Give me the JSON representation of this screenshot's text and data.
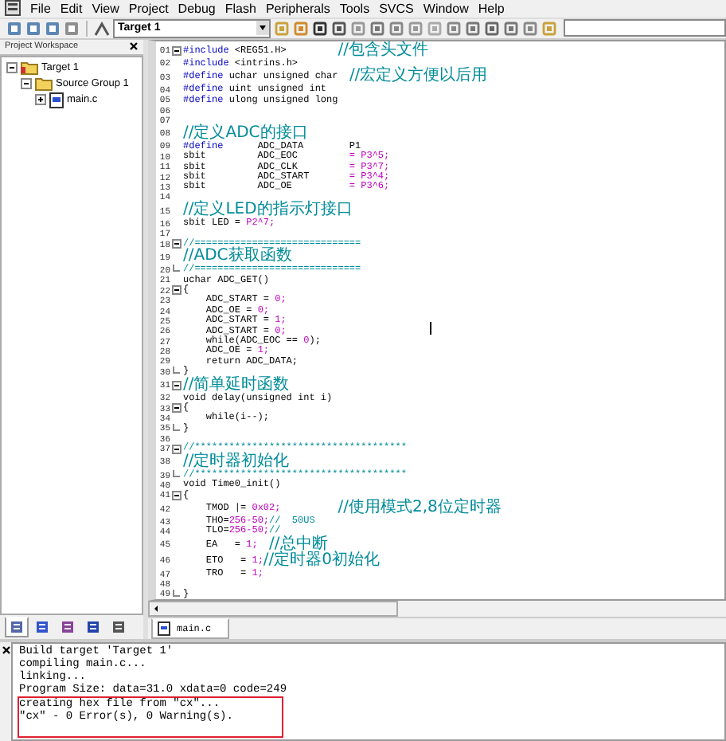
{
  "menu": [
    "File",
    "Edit",
    "View",
    "Project",
    "Debug",
    "Flash",
    "Peripherals",
    "Tools",
    "SVCS",
    "Window",
    "Help"
  ],
  "toolbar": {
    "target": "Target 1"
  },
  "workspace": {
    "title": "Project Workspace",
    "tree": [
      {
        "label": "Target 1",
        "kind": "target",
        "expanded": true,
        "children": [
          {
            "label": "Source Group 1",
            "kind": "group",
            "expanded": true,
            "children": [
              {
                "label": "main.c",
                "kind": "file",
                "expanded": false
              }
            ]
          }
        ]
      }
    ],
    "tabs": [
      {
        "kind": "files",
        "selected": true
      },
      {
        "kind": "regs",
        "selected": false
      },
      {
        "kind": "books",
        "selected": false
      },
      {
        "kind": "funcs",
        "selected": false
      },
      {
        "kind": "templates",
        "selected": false
      }
    ]
  },
  "editor": {
    "lines": [
      {
        "no": "01",
        "fold_start": true,
        "parts": [
          {
            "kind": "kw",
            "text": "#include"
          },
          {
            "kind": "plain",
            "text": " <REG51.H>         "
          },
          {
            "kind": "note",
            "text": "//包含头文件"
          }
        ]
      },
      {
        "no": "02",
        "parts": [
          {
            "kind": "kw",
            "text": "#include"
          },
          {
            "kind": "plain",
            "text": " <intrins.h>"
          }
        ]
      },
      {
        "no": "03",
        "parts": [
          {
            "kind": "kw",
            "text": "#define"
          },
          {
            "kind": "plain",
            "text": " uchar unsigned char  "
          },
          {
            "kind": "note",
            "text": "//宏定义方便以后用"
          }
        ]
      },
      {
        "no": "04",
        "parts": [
          {
            "kind": "kw",
            "text": "#define"
          },
          {
            "kind": "plain",
            "text": " uint unsigned int"
          }
        ]
      },
      {
        "no": "05",
        "parts": [
          {
            "kind": "kw",
            "text": "#define"
          },
          {
            "kind": "plain",
            "text": " ulong unsigned long"
          }
        ]
      },
      {
        "no": "06"
      },
      {
        "no": "07"
      },
      {
        "no": "08",
        "parts": [
          {
            "kind": "note",
            "text": "//定义ADC的接口"
          }
        ]
      },
      {
        "no": "09",
        "parts": [
          {
            "kind": "kw",
            "text": "#define"
          },
          {
            "kind": "plain",
            "text": "      ADC_DATA        P1"
          }
        ]
      },
      {
        "no": "10",
        "parts": [
          {
            "kind": "plain",
            "text": "sbit         ADC_EOC         "
          },
          {
            "kind": "num",
            "text": "= P3^5;"
          }
        ]
      },
      {
        "no": "11",
        "parts": [
          {
            "kind": "plain",
            "text": "sbit         ADC_CLK         "
          },
          {
            "kind": "num",
            "text": "= P3^7;"
          }
        ]
      },
      {
        "no": "12",
        "parts": [
          {
            "kind": "plain",
            "text": "sbit         ADC_START       "
          },
          {
            "kind": "num",
            "text": "= P3^4;"
          }
        ]
      },
      {
        "no": "13",
        "parts": [
          {
            "kind": "plain",
            "text": "sbit         ADC_OE          "
          },
          {
            "kind": "num",
            "text": "= P3^6;"
          }
        ]
      },
      {
        "no": "14"
      },
      {
        "no": "15",
        "parts": [
          {
            "kind": "note",
            "text": "//定义LED的指示灯接口"
          }
        ]
      },
      {
        "no": "16",
        "parts": [
          {
            "kind": "plain",
            "text": "sbit LED = "
          },
          {
            "kind": "num",
            "text": "P2^7;"
          }
        ]
      },
      {
        "no": "17"
      },
      {
        "no": "18",
        "fold_start": true,
        "parts": [
          {
            "kind": "cmt",
            "text": "//============================="
          }
        ]
      },
      {
        "no": "19",
        "parts": [
          {
            "kind": "note",
            "text": "//ADC获取函数"
          }
        ]
      },
      {
        "no": "20",
        "fold_end": true,
        "parts": [
          {
            "kind": "cmt",
            "text": "//============================="
          }
        ]
      },
      {
        "no": "21",
        "parts": [
          {
            "kind": "plain",
            "text": "uchar ADC_GET()"
          }
        ]
      },
      {
        "no": "22",
        "fold_start": true,
        "parts": [
          {
            "kind": "plain",
            "text": "{"
          }
        ]
      },
      {
        "no": "23",
        "parts": [
          {
            "kind": "plain",
            "text": "    ADC_START = "
          },
          {
            "kind": "num",
            "text": "0;"
          }
        ]
      },
      {
        "no": "24",
        "parts": [
          {
            "kind": "plain",
            "text": "    ADC_OE = "
          },
          {
            "kind": "num",
            "text": "0;"
          }
        ]
      },
      {
        "no": "25",
        "parts": [
          {
            "kind": "plain",
            "text": "    ADC_START = "
          },
          {
            "kind": "num",
            "text": "1;"
          }
        ]
      },
      {
        "no": "26",
        "parts": [
          {
            "kind": "plain",
            "text": "    ADC_START = "
          },
          {
            "kind": "num",
            "text": "0;"
          }
        ]
      },
      {
        "no": "27",
        "parts": [
          {
            "kind": "plain",
            "text": "    while(ADC_EOC == "
          },
          {
            "kind": "num",
            "text": "0"
          },
          {
            "kind": "plain",
            "text": ");"
          }
        ]
      },
      {
        "no": "28",
        "parts": [
          {
            "kind": "plain",
            "text": "    ADC_OE = "
          },
          {
            "kind": "num",
            "text": "1;"
          }
        ]
      },
      {
        "no": "29",
        "parts": [
          {
            "kind": "plain",
            "text": "    return ADC_DATA;"
          }
        ]
      },
      {
        "no": "30",
        "fold_end": true,
        "parts": [
          {
            "kind": "plain",
            "text": "}"
          }
        ]
      },
      {
        "no": "31",
        "fold_start": true,
        "parts": [
          {
            "kind": "note",
            "text": "//简单延时函数"
          }
        ]
      },
      {
        "no": "32",
        "parts": [
          {
            "kind": "plain",
            "text": "void delay(unsigned int i)"
          }
        ]
      },
      {
        "no": "33",
        "fold_start": true,
        "parts": [
          {
            "kind": "plain",
            "text": "{"
          }
        ]
      },
      {
        "no": "34",
        "parts": [
          {
            "kind": "plain",
            "text": "    while(i--);"
          }
        ]
      },
      {
        "no": "35",
        "fold_end": true,
        "parts": [
          {
            "kind": "plain",
            "text": "}"
          }
        ]
      },
      {
        "no": "36"
      },
      {
        "no": "37",
        "fold_start": true,
        "parts": [
          {
            "kind": "cmt",
            "text": "//*************************************"
          }
        ]
      },
      {
        "no": "38",
        "parts": [
          {
            "kind": "note",
            "text": "//定时器初始化"
          }
        ]
      },
      {
        "no": "39",
        "fold_end": true,
        "parts": [
          {
            "kind": "cmt",
            "text": "//*************************************"
          }
        ]
      },
      {
        "no": "40",
        "parts": [
          {
            "kind": "plain",
            "text": "void Time0_init()"
          }
        ]
      },
      {
        "no": "41",
        "fold_start": true,
        "parts": [
          {
            "kind": "plain",
            "text": "{"
          }
        ]
      },
      {
        "no": "42",
        "parts": [
          {
            "kind": "plain",
            "text": "    TMOD |= "
          },
          {
            "kind": "num",
            "text": "0x02;          "
          },
          {
            "kind": "note",
            "text": "//使用模式2,8位定时器"
          }
        ]
      },
      {
        "no": "43",
        "parts": [
          {
            "kind": "plain",
            "text": "    THO="
          },
          {
            "kind": "num",
            "text": "256-50;"
          },
          {
            "kind": "cmt",
            "text": "//  50US"
          }
        ]
      },
      {
        "no": "44",
        "parts": [
          {
            "kind": "plain",
            "text": "    TLO="
          },
          {
            "kind": "num",
            "text": "256-50;"
          },
          {
            "kind": "cmt",
            "text": "//"
          }
        ]
      },
      {
        "no": "45",
        "parts": [
          {
            "kind": "plain",
            "text": "    EA   = "
          },
          {
            "kind": "num",
            "text": "1;  "
          },
          {
            "kind": "note",
            "text": "//总中断"
          }
        ]
      },
      {
        "no": "46",
        "parts": [
          {
            "kind": "plain",
            "text": "    ETO   = "
          },
          {
            "kind": "num",
            "text": "1;"
          },
          {
            "kind": "note",
            "text": "//定时器0初始化"
          }
        ]
      },
      {
        "no": "47",
        "parts": [
          {
            "kind": "plain",
            "text": "    TRO   = "
          },
          {
            "kind": "num",
            "text": "1;"
          }
        ]
      },
      {
        "no": "48"
      },
      {
        "no": "49",
        "fold_end": true,
        "parts": [
          {
            "kind": "plain",
            "text": "}"
          }
        ]
      }
    ],
    "tabs": [
      {
        "label": "main.c",
        "selected": true
      }
    ]
  },
  "output": {
    "lines": [
      {
        "text": "Build target 'Target 1'",
        "boxed": false
      },
      {
        "text": "compiling main.c...",
        "boxed": false
      },
      {
        "text": "linking...",
        "boxed": false
      },
      {
        "text": "Program Size: data=31.0 xdata=0 code=249",
        "boxed": false
      },
      {
        "text": "creating hex file from \"cx\"...",
        "boxed": true
      },
      {
        "text": "\"cx\" - 0 Error(s), 0 Warning(s).",
        "boxed": true
      }
    ]
  }
}
